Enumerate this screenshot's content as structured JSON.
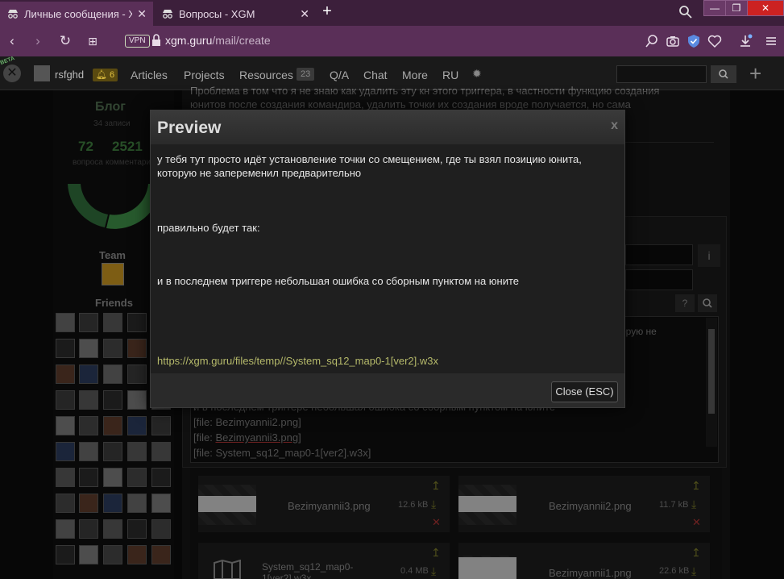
{
  "browser": {
    "tabs": [
      {
        "title": "Личные сообщения - XGM",
        "active": true
      },
      {
        "title": "Вопросы - XGM",
        "active": false
      }
    ],
    "url_host": "xgm.guru",
    "url_path": "/mail/create",
    "vpn_label": "VPN"
  },
  "site": {
    "beta": "BETA",
    "username": "rsfghd",
    "notif_count": "6",
    "nav": [
      "Articles",
      "Projects",
      "Resources",
      "Q/A",
      "Chat",
      "More",
      "RU"
    ],
    "resources_badge": "23"
  },
  "sidebar": {
    "blog_title": "Блог",
    "blog_count": "34 записи",
    "questions_num": "72",
    "comments_num": "2521",
    "questions_label": "вопроса",
    "comments_label": "комментари",
    "team_label": "Team",
    "friends_label": "Friends"
  },
  "content": {
    "top_text_1": "Проблема в том что я не знаю как удалить эту кн этого триггера, в частности функцию создания",
    "top_text_2": "юнитов после создания командира, удалить точки их создания вроде получается, но сама",
    "editor_right_text": "орую не",
    "editor_hidden_line": "и в последнем триггере небольшая ошибка со сборным пунктом на юните",
    "editor_lines": [
      {
        "prefix": "[file: ",
        "name": "Bezimyannii2.png",
        "suffix": "]"
      },
      {
        "prefix": "[file: ",
        "name": "Bezimyannii3.png",
        "suffix": "]"
      },
      {
        "prefix": "[file: ",
        "name": "System_sq12_map0-1[ver2].w3x",
        "suffix": "]"
      }
    ],
    "files": [
      {
        "name": "Bezimyannii3.png",
        "size": "12.6 kB"
      },
      {
        "name": "Bezimyannii2.png",
        "size": "11.7 kB"
      },
      {
        "name": "System_sq12_map0-1[ver2].w3x",
        "size": "0.4 MB"
      },
      {
        "name": "Bezimyannii1.png",
        "size": "22.6 kB"
      }
    ]
  },
  "modal": {
    "title": "Preview",
    "close_x": "x",
    "paragraph_1": "у тебя тут просто идёт установление точки со смещением, где ты взял позицию юнита, которую не запеременил предварительно",
    "paragraph_2": "правильно будет так:",
    "paragraph_3": "и в последнем триггере небольшая ошибка со сборным пунктом на юните",
    "link": "https://xgm.guru/files/temp//System_sq12_map0-1[ver2].w3x",
    "close_button": "Close (ESC)"
  }
}
